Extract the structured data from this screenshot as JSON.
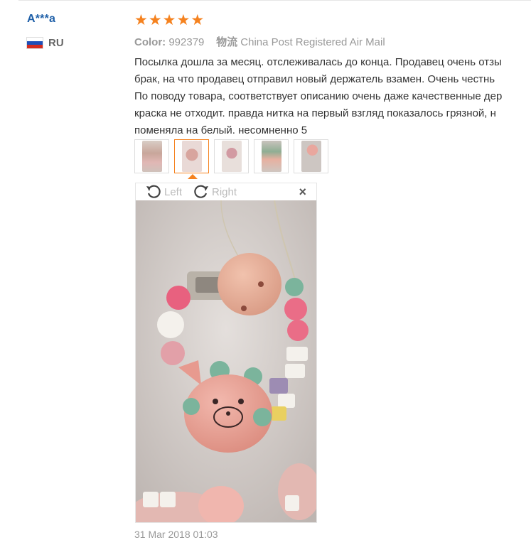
{
  "reviewer": {
    "name": "A***a",
    "country_code": "RU",
    "flag_colors": [
      "#ffffff",
      "#1e4fb8",
      "#d52b1e"
    ]
  },
  "review": {
    "rating": 5,
    "stars": [
      "★",
      "★",
      "★",
      "★",
      "★"
    ],
    "color_label": "Color:",
    "color_value": "992379",
    "shipping_label": "物流",
    "shipping_value": "China Post Registered Air Mail",
    "text_lines": [
      "Посылка дошла за месяц. отслеживалась до конца. Продавец очень отзы",
      "брак, на что продавец отправил новый держатель взамен. Очень честнь",
      "По поводу товара, соответствует описанию очень даже качественные дер",
      "краска не отходит. правда нитка на первый взгляд показалось грязной, н",
      "поменяла на белый. несомненно 5"
    ],
    "date": "31 Mar 2018 01:03"
  },
  "viewer": {
    "left_label": "Left",
    "right_label": "Right",
    "close_symbol": "×"
  },
  "colors": {
    "accent": "#f5821f",
    "link": "#1e5fa8"
  }
}
